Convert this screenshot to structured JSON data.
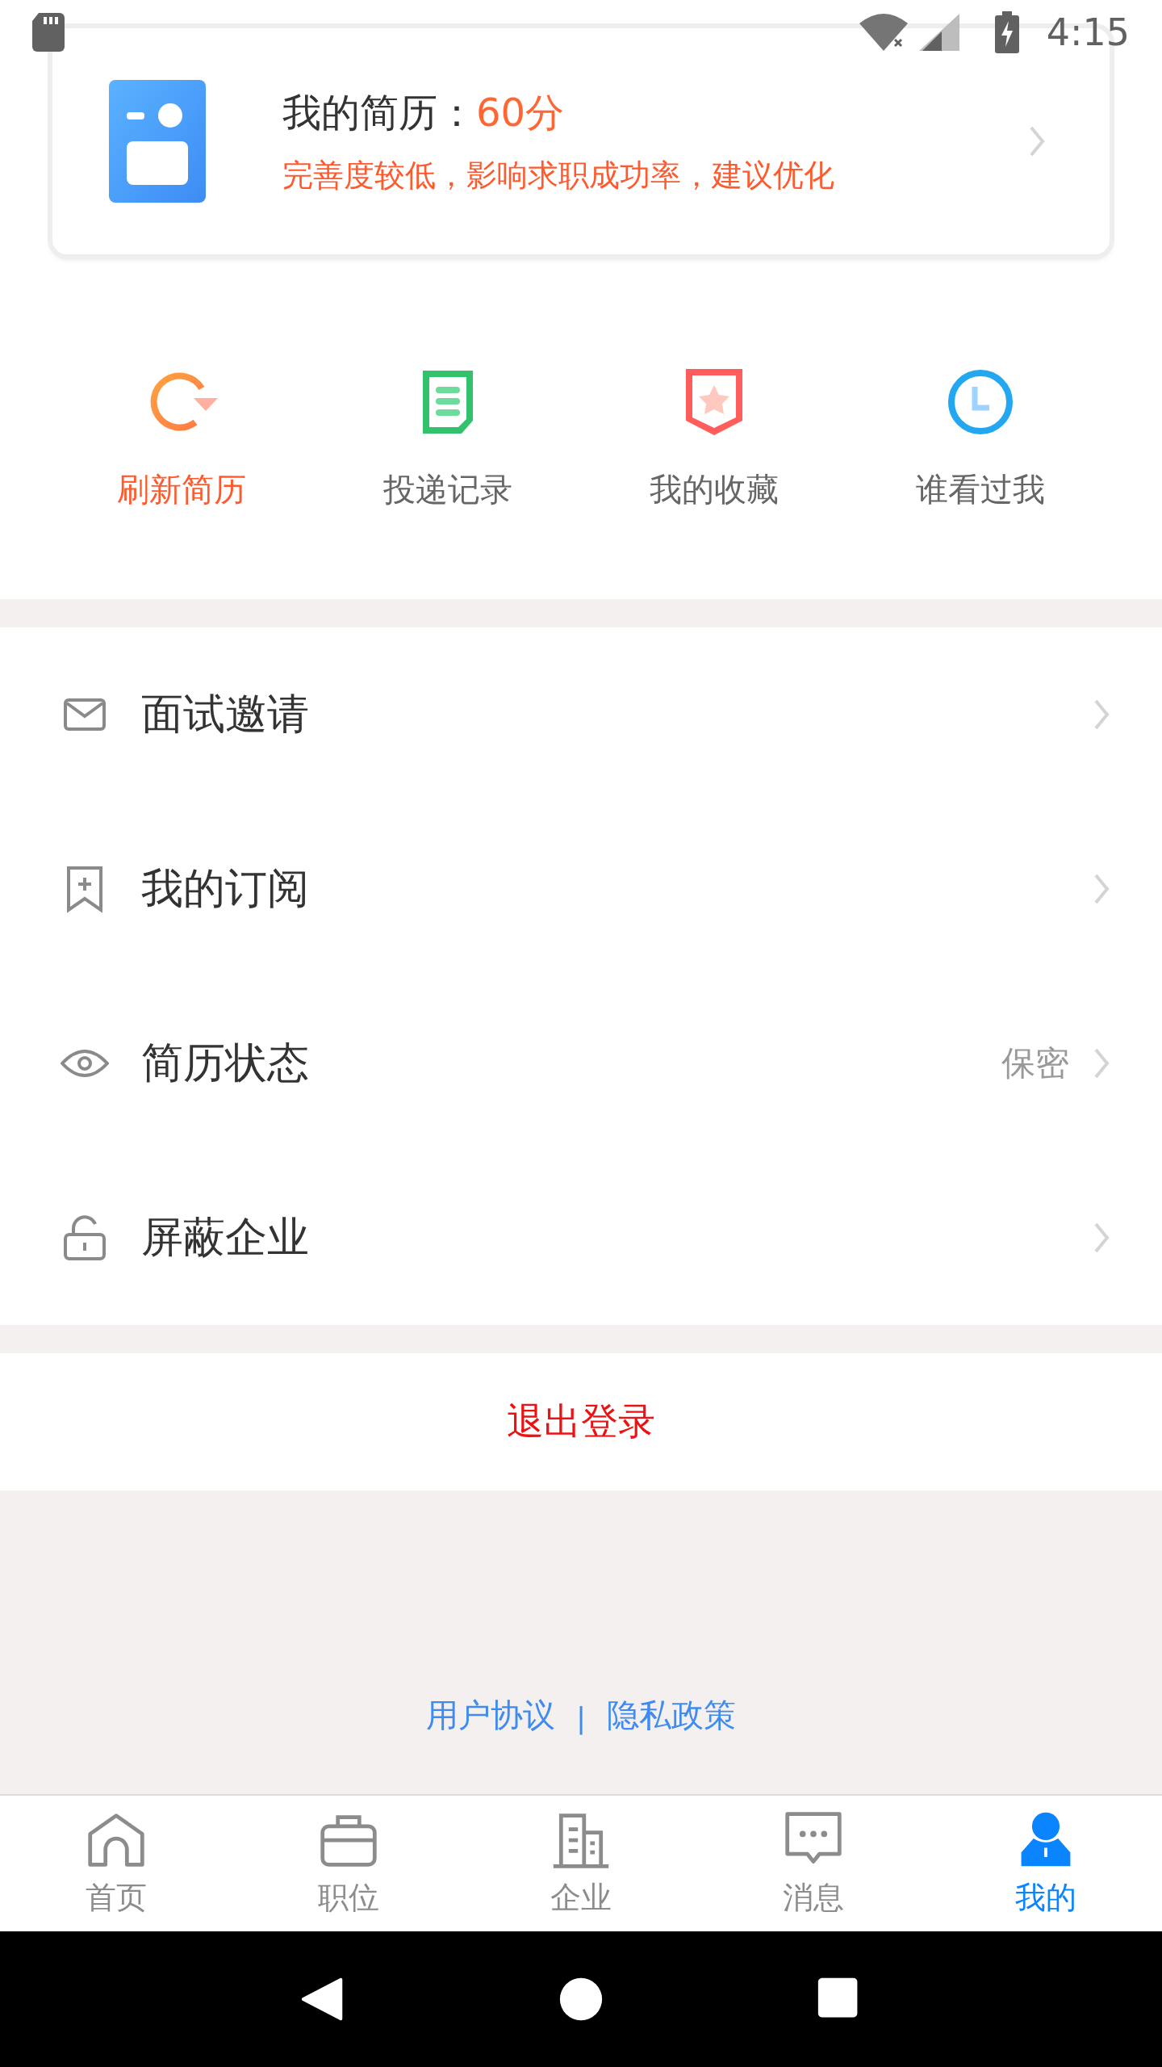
{
  "status_bar": {
    "time": "4:15"
  },
  "resume_card": {
    "title": "我的简历：",
    "score": "60分",
    "hint": "完善度较低，影响求职成功率，建议优化"
  },
  "quick_actions": [
    {
      "label": "刷新简历",
      "selected": true
    },
    {
      "label": "投递记录",
      "selected": false
    },
    {
      "label": "我的收藏",
      "selected": false
    },
    {
      "label": "谁看过我",
      "selected": false
    }
  ],
  "menu": [
    {
      "label": "面试邀请"
    },
    {
      "label": "我的订阅"
    },
    {
      "label": "简历状态",
      "value": "保密"
    },
    {
      "label": "屏蔽企业"
    }
  ],
  "logout": "退出登录",
  "footer_links": {
    "left": "用户协议",
    "separator": "|",
    "right": "隐私政策"
  },
  "tabs": [
    {
      "label": "首页",
      "selected": false
    },
    {
      "label": "职位",
      "selected": false
    },
    {
      "label": "企业",
      "selected": false
    },
    {
      "label": "消息",
      "selected": false
    },
    {
      "label": "我的",
      "selected": true
    }
  ]
}
